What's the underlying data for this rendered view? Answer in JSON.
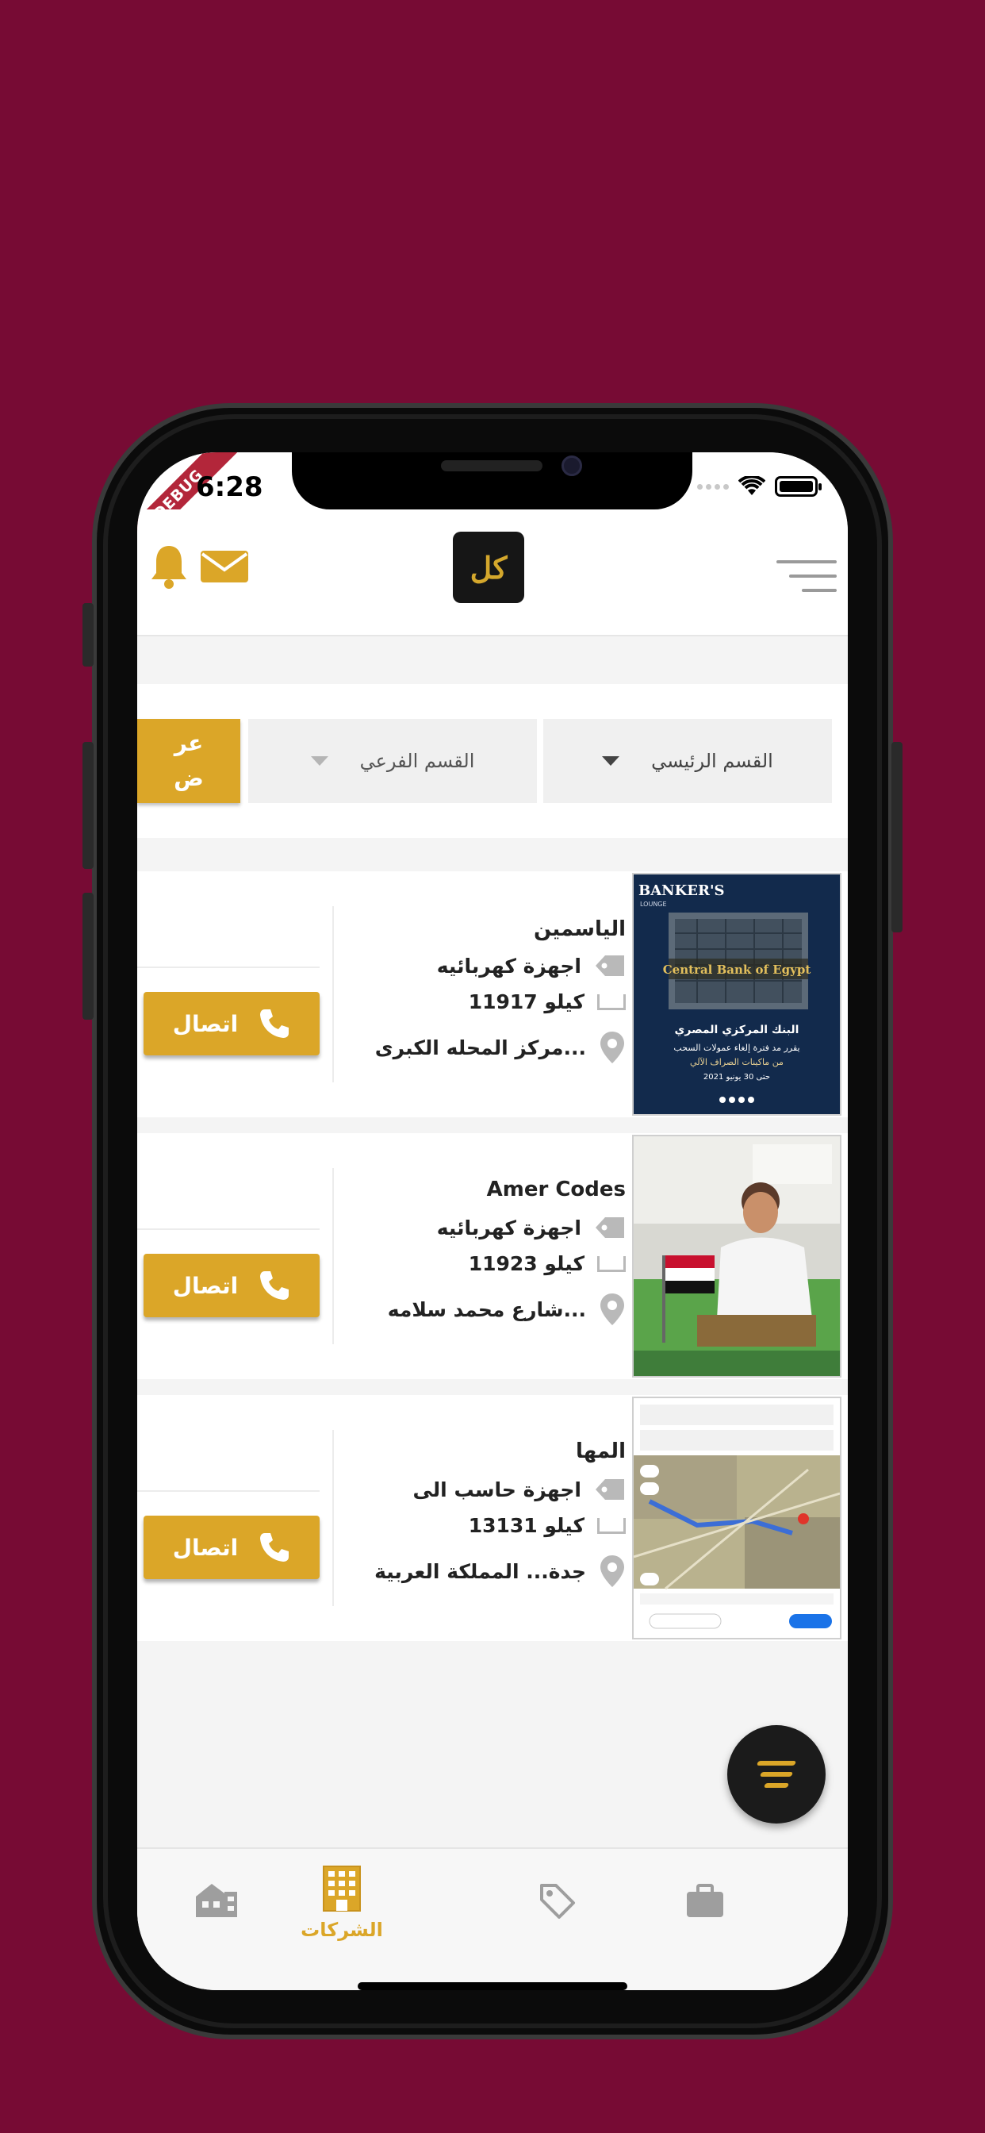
{
  "status_bar": {
    "time": "6:28",
    "debug_label": "DEBUG"
  },
  "header": {
    "logo_text": "كل"
  },
  "filter": {
    "main_category_value": "القسم الرئيسي",
    "sub_category_value": "القسم الفرعي",
    "show_button_line1": "عر",
    "show_button_line2": "ض"
  },
  "listings": [
    {
      "name": "الياسمين",
      "category": "اجهزة كهربائيه",
      "distance": "11917 كيلو",
      "address": "مركز المحله الكبرى...",
      "call_label": "اتصال",
      "image_text": {
        "brand": "BANKER'S",
        "brand_sub": "LOUNGE",
        "sign": "Central Bank of Egypt",
        "title": "البنك المركزي المصري",
        "line1": "يقرر مد فترة إلغاء عمولات السحب",
        "line2": "من ماكينات الصراف الآلي",
        "line3": "حتى 30 يونيو 2021"
      }
    },
    {
      "name": "Amer Codes",
      "category": "اجهزة كهربائيه",
      "distance": "11923 كيلو",
      "address": "شارع محمد سلامه...",
      "call_label": "اتصال"
    },
    {
      "name": "المها",
      "category": "اجهزة حاسب الى",
      "distance": "13131 كيلو",
      "address": "جدة... المملكة العربية",
      "call_label": "اتصال"
    }
  ],
  "bottom_nav": {
    "active_label": "الشركات"
  },
  "colors": {
    "background": "#770b34",
    "accent": "#dba628",
    "fab": "#1b1b1b"
  }
}
